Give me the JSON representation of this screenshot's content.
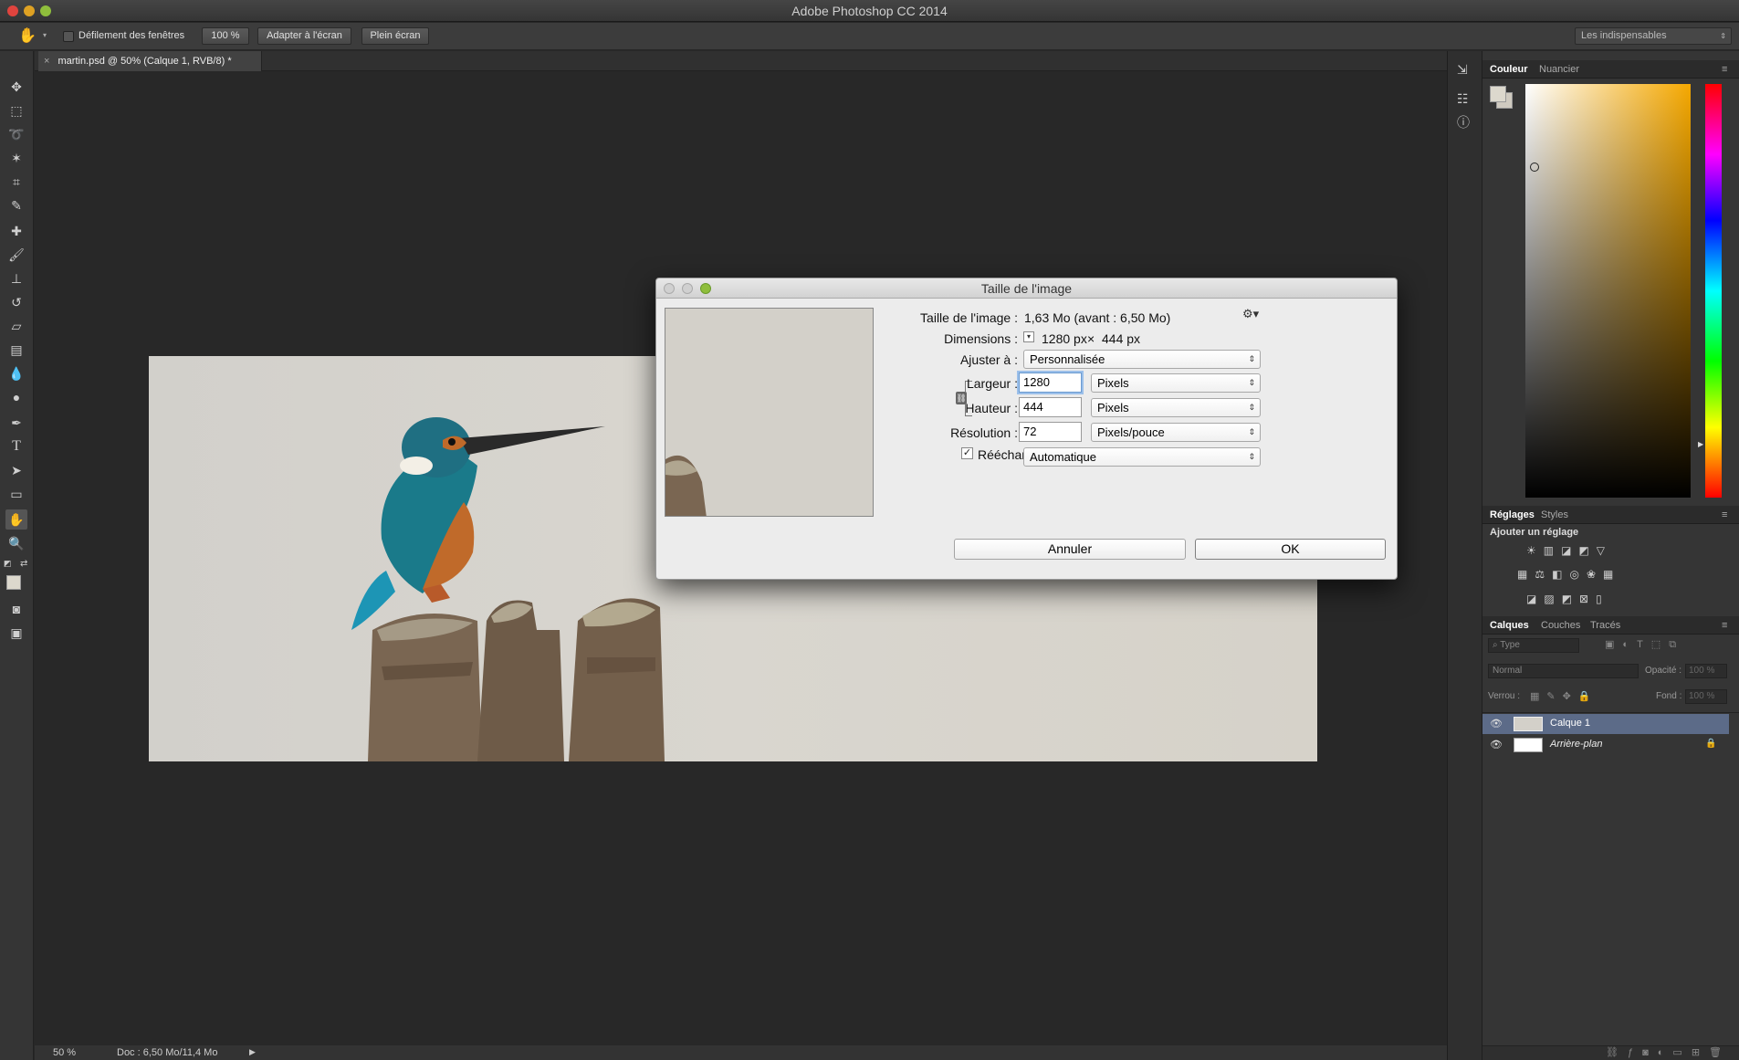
{
  "app": {
    "title": "Adobe Photoshop CC 2014"
  },
  "options_bar": {
    "scroll_all_label": "Défilement des fenêtres",
    "zoom_100_label": "100 %",
    "fit_screen_label": "Adapter à l'écran",
    "full_screen_label": "Plein écran",
    "workspace_label": "Les indispensables"
  },
  "document": {
    "tab_label": "martin.psd @ 50% (Calque 1, RVB/8) *",
    "zoom": "50 %",
    "doc_info": "Doc : 6,50 Mo/11,4 Mo"
  },
  "dialog": {
    "title": "Taille de l'image",
    "image_size_label": "Taille de l'image :",
    "image_size_value": "1,63 Mo (avant : 6,50 Mo)",
    "dimensions_label": "Dimensions :",
    "dim_width": "1280 px",
    "dim_times": "×",
    "dim_height": "444 px",
    "fit_label": "Ajuster à :",
    "fit_value": "Personnalisée",
    "width_label": "Largeur :",
    "width_value": "1280",
    "width_unit": "Pixels",
    "height_label": "Hauteur :",
    "height_value": "444",
    "height_unit": "Pixels",
    "resolution_label": "Résolution :",
    "resolution_value": "72",
    "resolution_unit": "Pixels/pouce",
    "resample_label": "Rééchantillonnage :",
    "resample_value": "Automatique",
    "cancel_label": "Annuler",
    "ok_label": "OK"
  },
  "color_panel": {
    "tabs": [
      "Couleur",
      "Nuancier"
    ]
  },
  "adjust_panel": {
    "tabs": [
      "Réglages",
      "Styles"
    ],
    "heading": "Ajouter un réglage"
  },
  "layers_panel": {
    "tabs": [
      "Calques",
      "Couches",
      "Tracés"
    ],
    "filter_label": "Type",
    "blend_mode": "Normal",
    "opacity_label": "Opacité :",
    "opacity_value": "100 %",
    "lock_label": "Verrou :",
    "fill_label": "Fond :",
    "fill_value": "100 %",
    "layers": [
      "Calque 1",
      "Arrière-plan"
    ]
  }
}
